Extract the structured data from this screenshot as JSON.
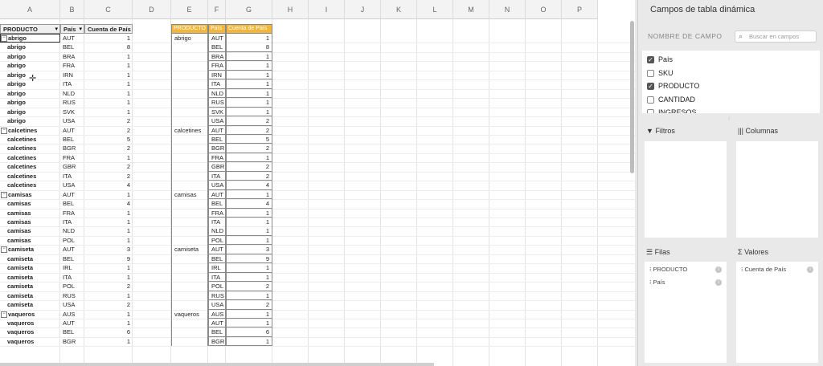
{
  "columns": [
    "A",
    "B",
    "C",
    "D",
    "E",
    "F",
    "G",
    "H",
    "I",
    "J",
    "K",
    "L",
    "M",
    "N",
    "O",
    "P"
  ],
  "pivot_headers": {
    "product": "PRODUCTO",
    "country": "País",
    "count": "Cuenta de País"
  },
  "table_headers": {
    "product": "PRODUCTO",
    "country": "País",
    "count": "Cuenta de País"
  },
  "rows": [
    {
      "group": "abrigo",
      "country": "AUT",
      "count": "1",
      "first": true
    },
    {
      "group": "abrigo",
      "country": "BEL",
      "count": "8"
    },
    {
      "group": "abrigo",
      "country": "BRA",
      "count": "1"
    },
    {
      "group": "abrigo",
      "country": "FRA",
      "count": "1"
    },
    {
      "group": "abrigo",
      "country": "IRN",
      "count": "1"
    },
    {
      "group": "abrigo",
      "country": "ITA",
      "count": "1"
    },
    {
      "group": "abrigo",
      "country": "NLD",
      "count": "1"
    },
    {
      "group": "abrigo",
      "country": "RUS",
      "count": "1"
    },
    {
      "group": "abrigo",
      "country": "SVK",
      "count": "1"
    },
    {
      "group": "abrigo",
      "country": "USA",
      "count": "2"
    },
    {
      "group": "calcetines",
      "country": "AUT",
      "count": "2",
      "first": true
    },
    {
      "group": "calcetines",
      "country": "BEL",
      "count": "5"
    },
    {
      "group": "calcetines",
      "country": "BGR",
      "count": "2"
    },
    {
      "group": "calcetines",
      "country": "FRA",
      "count": "1"
    },
    {
      "group": "calcetines",
      "country": "GBR",
      "count": "2"
    },
    {
      "group": "calcetines",
      "country": "ITA",
      "count": "2"
    },
    {
      "group": "calcetines",
      "country": "USA",
      "count": "4"
    },
    {
      "group": "camisas",
      "country": "AUT",
      "count": "1",
      "first": true
    },
    {
      "group": "camisas",
      "country": "BEL",
      "count": "4"
    },
    {
      "group": "camisas",
      "country": "FRA",
      "count": "1"
    },
    {
      "group": "camisas",
      "country": "ITA",
      "count": "1"
    },
    {
      "group": "camisas",
      "country": "NLD",
      "count": "1"
    },
    {
      "group": "camisas",
      "country": "POL",
      "count": "1"
    },
    {
      "group": "camiseta",
      "country": "AUT",
      "count": "3",
      "first": true
    },
    {
      "group": "camiseta",
      "country": "BEL",
      "count": "9"
    },
    {
      "group": "camiseta",
      "country": "IRL",
      "count": "1"
    },
    {
      "group": "camiseta",
      "country": "ITA",
      "count": "1"
    },
    {
      "group": "camiseta",
      "country": "POL",
      "count": "2"
    },
    {
      "group": "camiseta",
      "country": "RUS",
      "count": "1"
    },
    {
      "group": "camiseta",
      "country": "USA",
      "count": "2"
    },
    {
      "group": "vaqueros",
      "country": "AUS",
      "count": "1",
      "first": true
    },
    {
      "group": "vaqueros",
      "country": "AUT",
      "count": "1"
    },
    {
      "group": "vaqueros",
      "country": "BEL",
      "count": "6"
    },
    {
      "group": "vaqueros",
      "country": "BGR",
      "count": "1"
    }
  ],
  "panel": {
    "title": "Campos de tabla dinámica",
    "field_name_label": "NOMBRE DE CAMPO",
    "search_placeholder": "Buscar en campos",
    "fields": [
      {
        "label": "País",
        "checked": true
      },
      {
        "label": "SKU",
        "checked": false
      },
      {
        "label": "PRODUCTO",
        "checked": true
      },
      {
        "label": "CANTIDAD",
        "checked": false
      },
      {
        "label": "INGRESOS",
        "checked": false
      }
    ],
    "filters_label": "Filtros",
    "columns_label": "Columnas",
    "rows_label": "Filas",
    "values_label": "Valores",
    "rows_items": [
      "PRODUCTO",
      "País"
    ],
    "values_items": [
      "Cuenta de País"
    ]
  }
}
